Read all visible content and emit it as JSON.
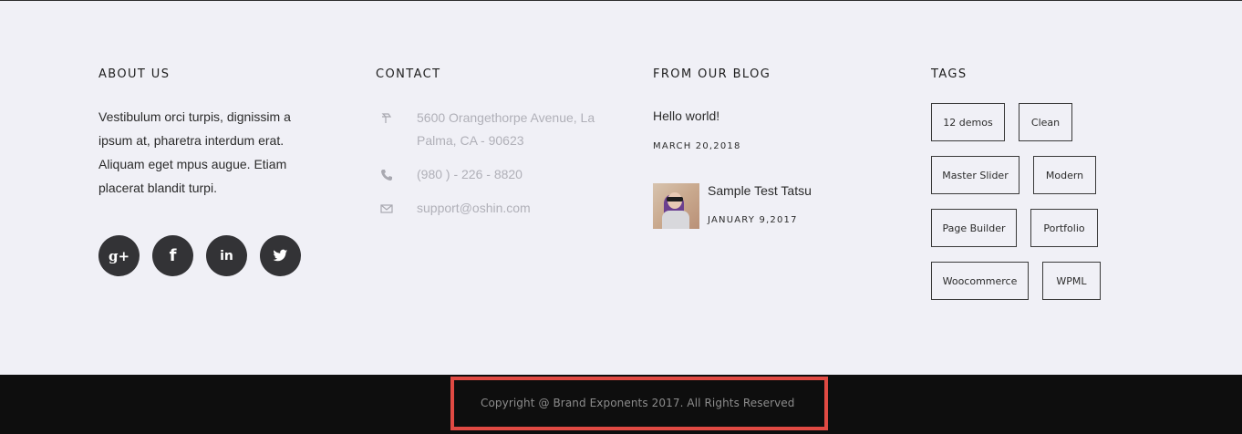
{
  "about": {
    "heading": "ABOUT US",
    "text": "Vestibulum orci turpis, dignissim a ipsum at, pharetra interdum erat. Aliquam eget mpus augue. Etiam placerat blandit turpi.",
    "socials": [
      {
        "name": "google-plus-icon",
        "glyph": "g+"
      },
      {
        "name": "facebook-icon",
        "glyph": "f"
      },
      {
        "name": "linkedin-icon",
        "glyph": "in"
      },
      {
        "name": "twitter-icon",
        "glyph": "bird"
      }
    ]
  },
  "contact": {
    "heading": "CONTACT",
    "address": "5600 Orangethorpe Avenue, La Palma, CA - 90623",
    "phone": "(980 ) - 226 - 8820",
    "email": "support@oshin.com"
  },
  "blog": {
    "heading": "FROM OUR BLOG",
    "posts": [
      {
        "title": "Hello world!",
        "date": "MARCH 20,2018"
      },
      {
        "title": "Sample Test Tatsu",
        "date": "JANUARY 9,2017"
      }
    ]
  },
  "tags": {
    "heading": "TAGS",
    "items": [
      "12 demos",
      "Clean",
      "Master Slider",
      "Modern",
      "Page Builder",
      "Portfolio",
      "Woocommerce",
      "WPML"
    ]
  },
  "copyright": {
    "text": "Copyright @ Brand Exponents 2017. All Rights Reserved"
  },
  "colors": {
    "background": "#f0f0f6",
    "bar": "#0e0e0e",
    "highlight": "#e04a43",
    "social": "#333336"
  }
}
